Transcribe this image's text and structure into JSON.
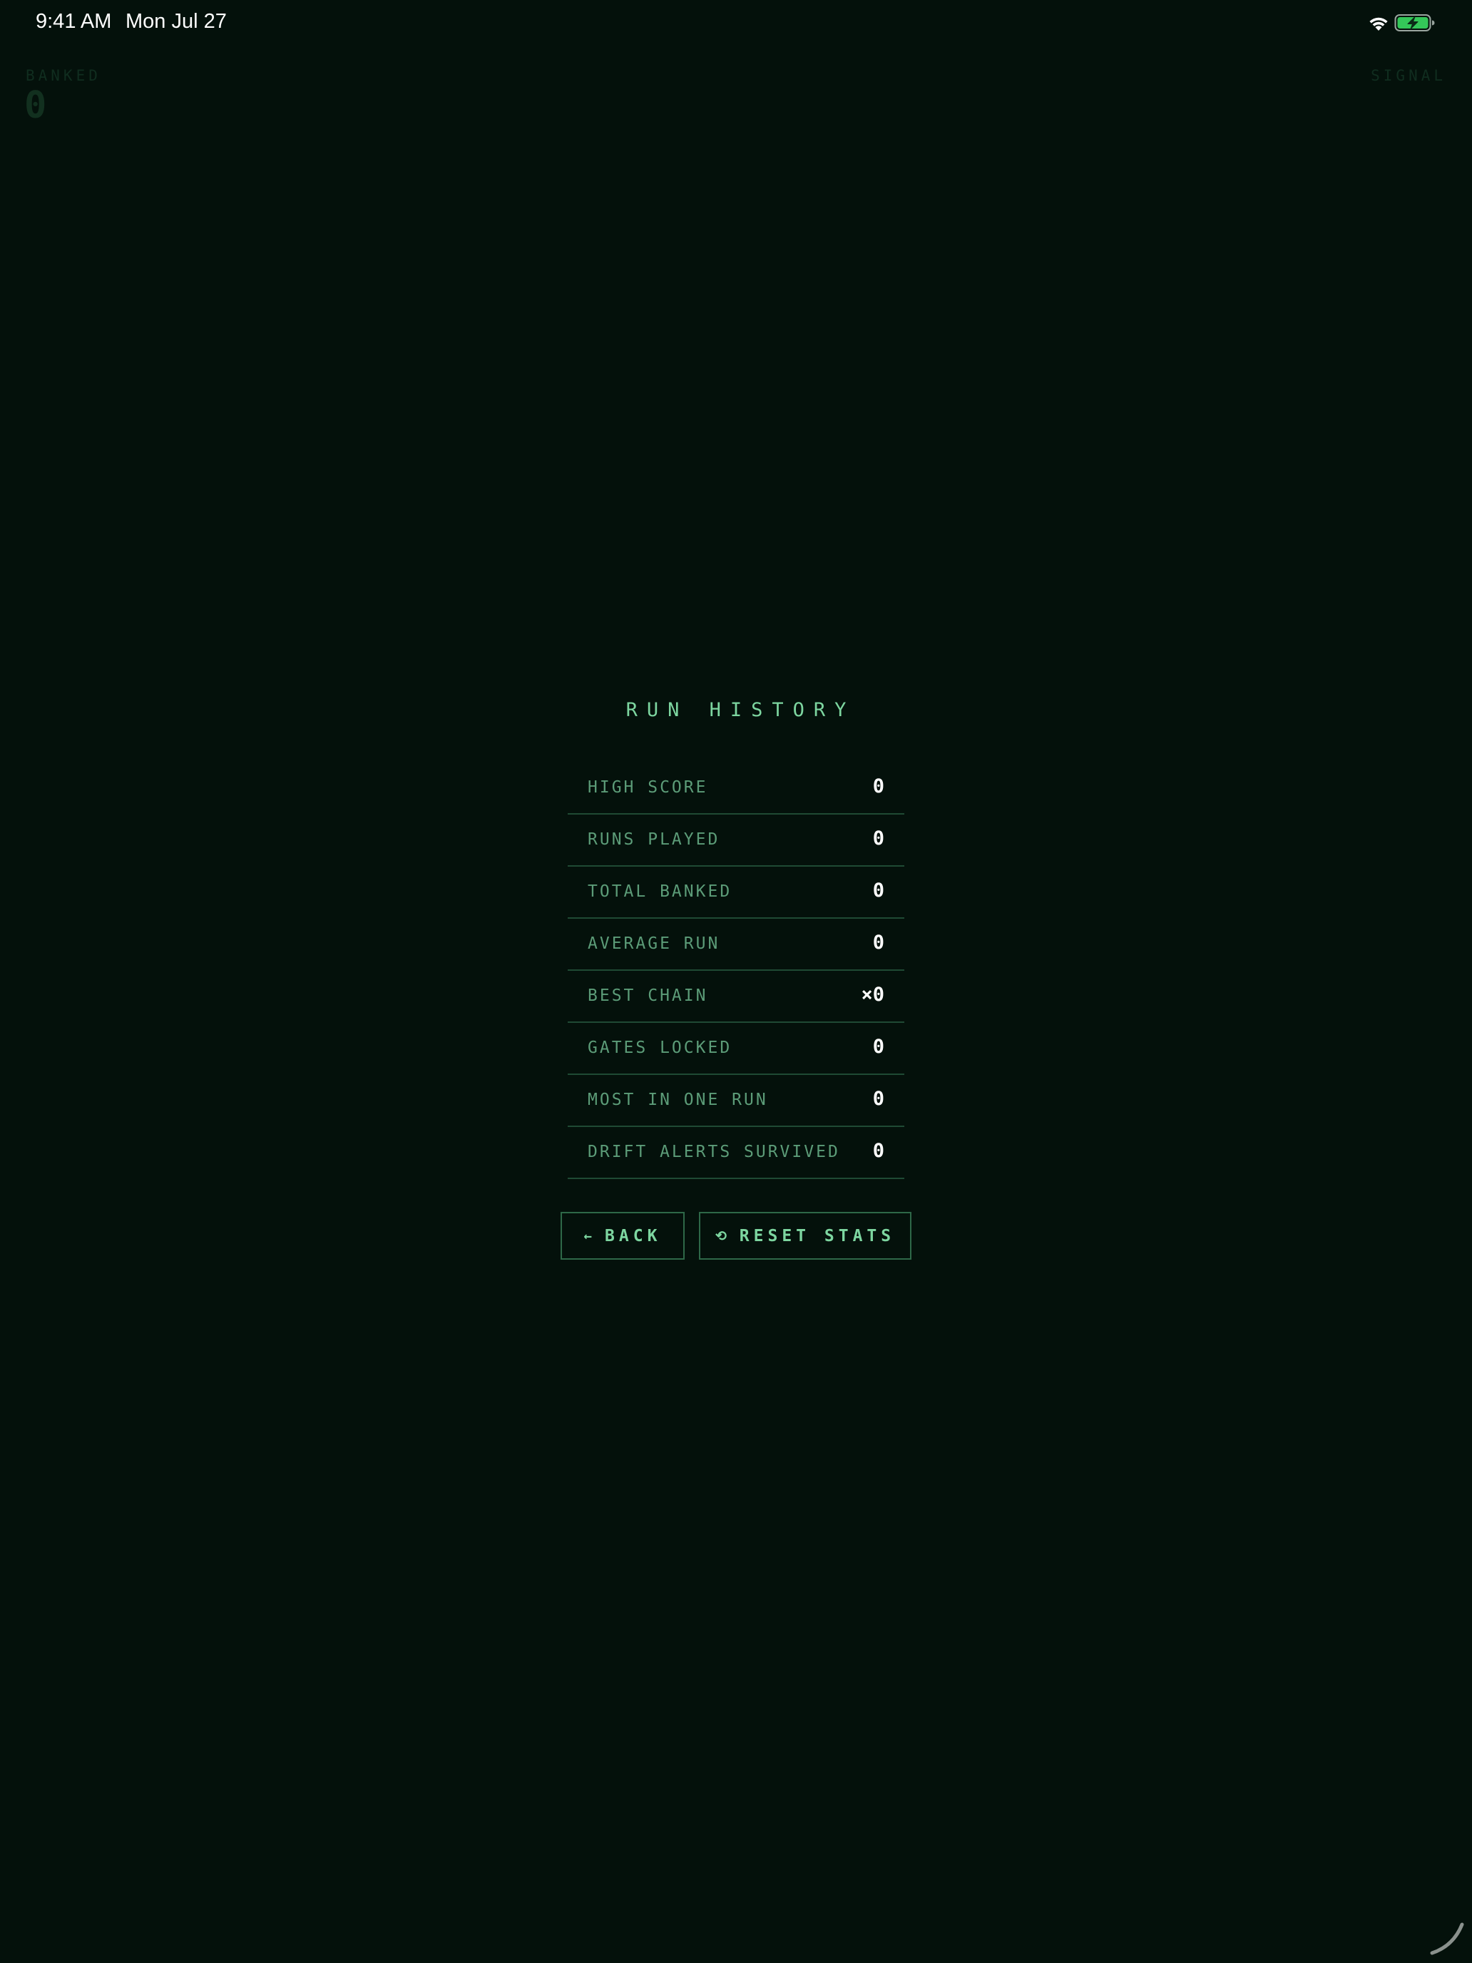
{
  "status_bar": {
    "time": "9:41 AM",
    "date": "Mon Jul 27",
    "icons": [
      "wifi-icon",
      "battery-charging-icon"
    ]
  },
  "hud": {
    "banked_label": "BANKED",
    "banked_value": "0",
    "signal_label": "SIGNAL"
  },
  "run_history": {
    "title": "RUN HISTORY",
    "stats": [
      {
        "label": "HIGH SCORE",
        "value": "0"
      },
      {
        "label": "RUNS PLAYED",
        "value": "0"
      },
      {
        "label": "TOTAL BANKED",
        "value": "0"
      },
      {
        "label": "AVERAGE RUN",
        "value": "0"
      },
      {
        "label": "BEST CHAIN",
        "value": "×0"
      },
      {
        "label": "GATES LOCKED",
        "value": "0"
      },
      {
        "label": "MOST IN ONE RUN",
        "value": "0"
      },
      {
        "label": "DRIFT ALERTS SURVIVED",
        "value": "0"
      }
    ]
  },
  "buttons": {
    "back_icon": "←",
    "back_label": "BACK",
    "reset_icon": "⟲",
    "reset_label": "RESET STATS"
  },
  "colors": {
    "background": "#04110b",
    "accent": "#7dd6a0",
    "label": "#5c9c78",
    "divider": "#1f4a34",
    "battery": "#34c759"
  }
}
